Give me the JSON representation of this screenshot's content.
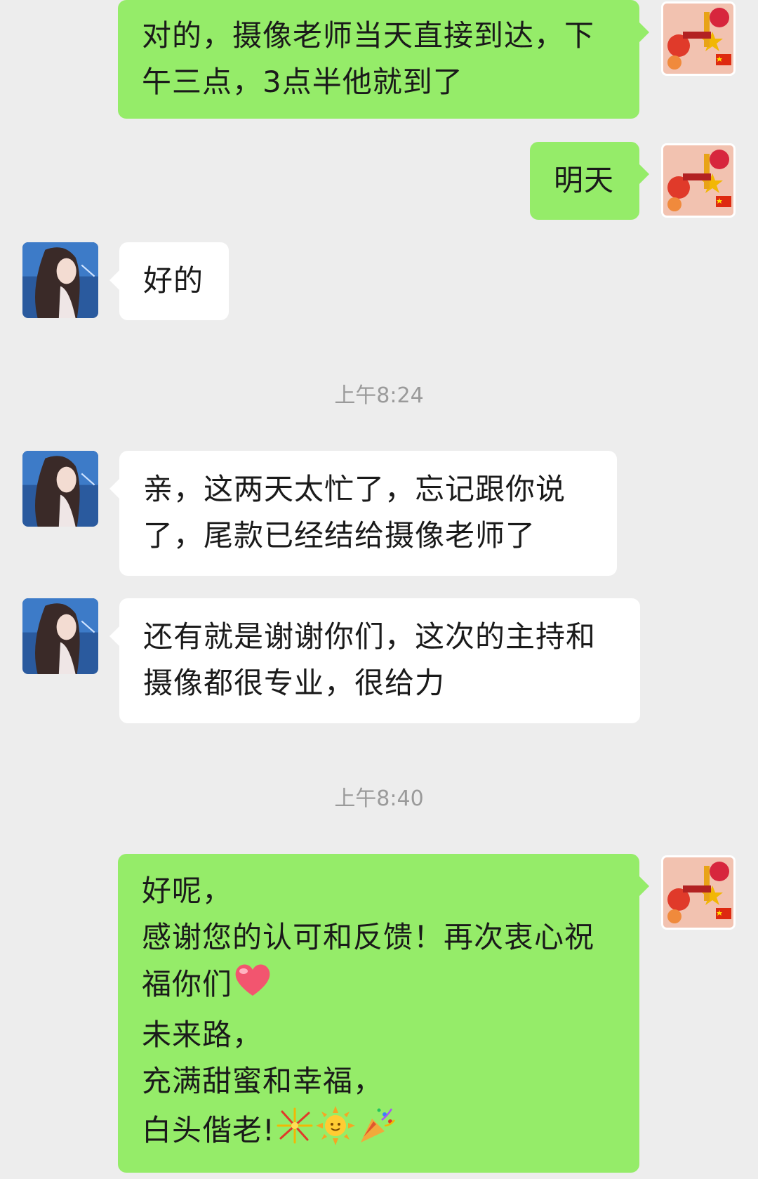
{
  "messages": [
    {
      "id": "m1",
      "sender": "me",
      "lines": [
        "对的，摄像老师当天直接到达，下",
        "午三点，3点半他就到了"
      ]
    },
    {
      "id": "m2",
      "sender": "me",
      "lines": [
        "明天"
      ]
    },
    {
      "id": "m3",
      "sender": "them",
      "lines": [
        "好的"
      ]
    },
    {
      "id": "t1",
      "type": "timestamp",
      "text": "上午8:24"
    },
    {
      "id": "m4",
      "sender": "them",
      "lines": [
        "亲，这两天太忙了，忘记跟你说",
        "了，尾款已经结给摄像老师了"
      ]
    },
    {
      "id": "m5",
      "sender": "them",
      "lines": [
        "还有就是谢谢你们，这次的主持和",
        "摄像都很专业，很给力"
      ]
    },
    {
      "id": "t2",
      "type": "timestamp",
      "text": "上午8:40"
    },
    {
      "id": "m6",
      "sender": "me",
      "lines": [
        "好呢，",
        "感谢您的认可和反馈！再次衷心祝",
        "福你们",
        "未来路，",
        "充满甜蜜和幸福，",
        "白头偕老!"
      ],
      "emoji": [
        "heart-emoji",
        "fireworks-emoji",
        "sun-emoji",
        "party-popper-emoji"
      ]
    }
  ],
  "colors": {
    "background": "#ededed",
    "my_bubble": "#95ec69",
    "their_bubble": "#ffffff",
    "timestamp_text": "#9a9a9a"
  }
}
